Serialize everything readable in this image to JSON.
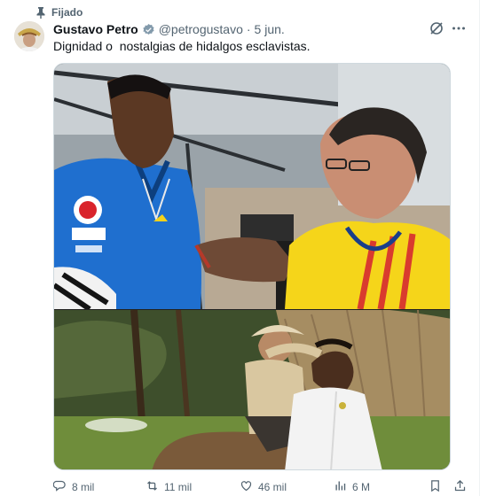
{
  "pinned": {
    "label": "Fijado",
    "icon": "pin-icon"
  },
  "author": {
    "name": "Gustavo Petro",
    "handle": "@petrogustavo",
    "separator": "·",
    "date": "5 jun.",
    "verified_icon": "verified-badge-icon"
  },
  "tweet": {
    "text": "Dignidad o  nostalgias de hidalgos esclavistas."
  },
  "media": [
    {
      "icon": "photo-footballer-and-politician"
    },
    {
      "icon": "photo-horseback-rider-and-man"
    }
  ],
  "actions": {
    "replies": "8 mil",
    "retweets": "11 mil",
    "likes": "46 mil",
    "views": "6 M"
  },
  "colors": {
    "text": "#0f1419",
    "secondary": "#536471",
    "verified": "#829aab",
    "border": "#cfd9de"
  }
}
